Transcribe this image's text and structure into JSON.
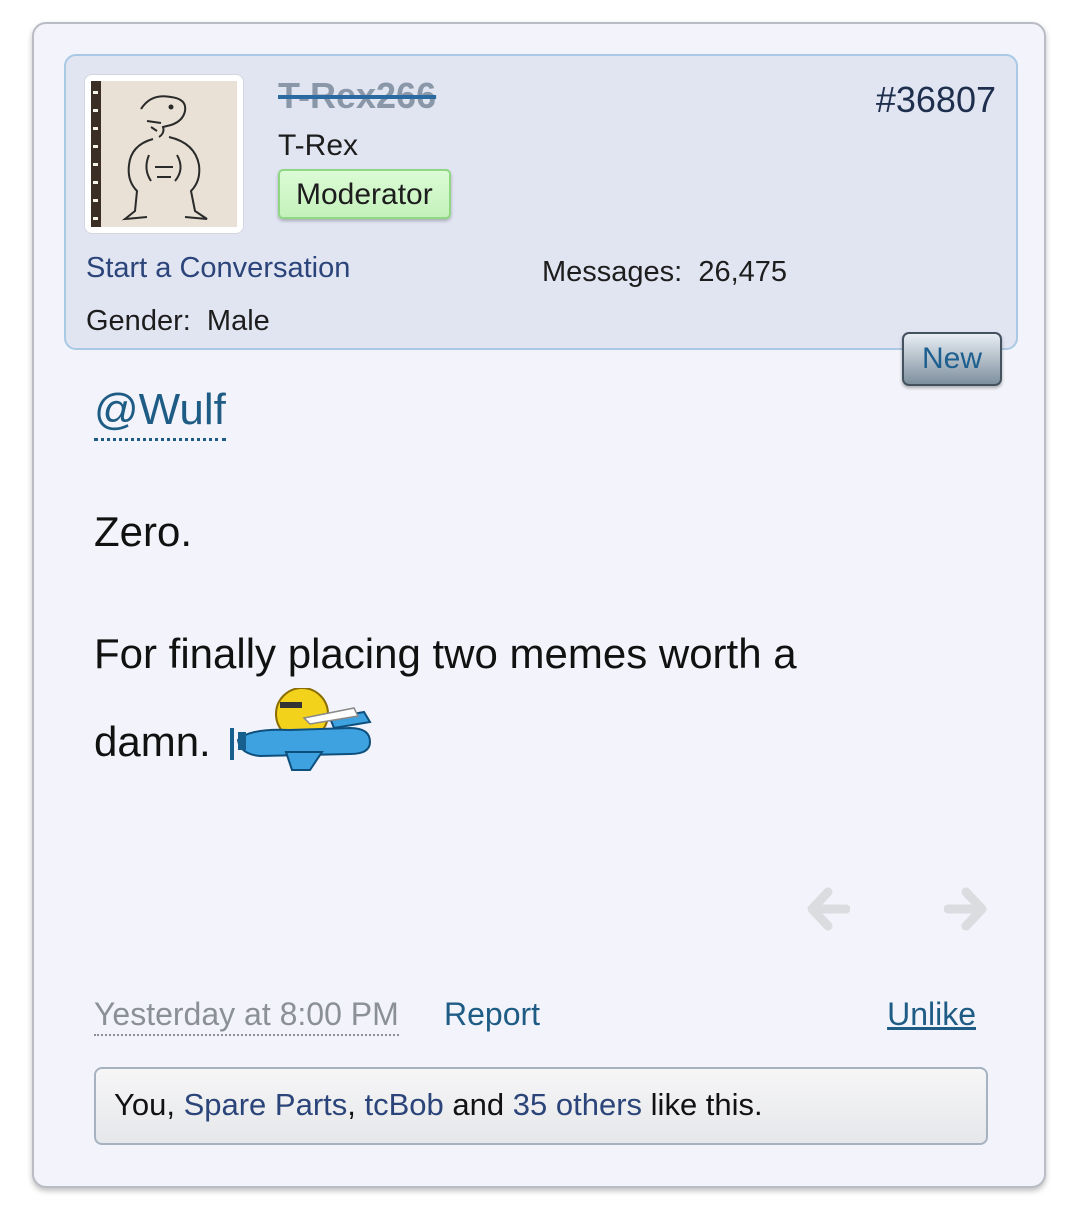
{
  "post": {
    "username": "T-Rex266",
    "user_title": "T-Rex",
    "role_badge": "Moderator",
    "post_number": "#36807",
    "start_conversation": "Start a Conversation",
    "messages_label": "Messages:",
    "messages_count": "26,475",
    "gender_label": "Gender:",
    "gender_value": "Male",
    "new_badge": "New"
  },
  "message": {
    "mention": "@Wulf",
    "line1": "Zero.",
    "line2": "For finally placing two memes worth a",
    "line3": "damn.",
    "smiley": "airplane-smiley-icon"
  },
  "footer": {
    "timestamp": "Yesterday at 8:00 PM",
    "report": "Report",
    "unlike": "Unlike"
  },
  "likes": {
    "you": "You,",
    "user1": "Spare Parts",
    "sep1": ",",
    "user2": "tcBob",
    "and": "and",
    "others": "35 others",
    "suffix": "like this."
  },
  "nav": {
    "prev_icon": "arrow-left-icon",
    "next_icon": "arrow-right-icon"
  },
  "colors": {
    "card_bg": "#f3f4fb",
    "userbox_bg": "#e1e5f2",
    "link": "#1f5c85",
    "moderator_green": "#c4f2bb"
  }
}
